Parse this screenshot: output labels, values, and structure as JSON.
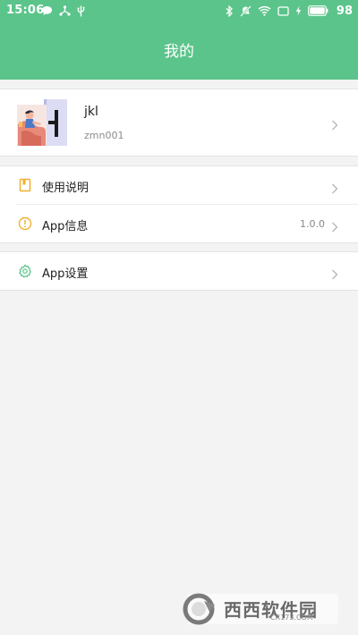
{
  "status_bar": {
    "time": "15:06",
    "battery_percent": "98",
    "left_icons": [
      "chat-bubble-icon",
      "usb-share-icon",
      "usb-icon"
    ],
    "right_icons": [
      "bluetooth-icon",
      "mute-icon",
      "wifi-icon",
      "screen-icon",
      "charging-icon",
      "battery-icon"
    ]
  },
  "header": {
    "title": "我的"
  },
  "profile": {
    "name": "jkl",
    "id": "zmn001",
    "avatar_icon": "avatar-illustration"
  },
  "menu": {
    "group1": [
      {
        "label": "使用说明",
        "icon": "book-icon",
        "value": ""
      },
      {
        "label": "App信息",
        "icon": "info-icon",
        "value": "1.0.0"
      }
    ],
    "group2": [
      {
        "label": "App设置",
        "icon": "gear-icon",
        "value": ""
      }
    ]
  },
  "watermark": {
    "text": "西西软件园",
    "sub": "CR173.COM"
  },
  "colors": {
    "header_bg": "#5bc48b",
    "page_bg": "#f3f3f3",
    "icon_orange": "#f0b030",
    "icon_green": "#5bc48b"
  }
}
